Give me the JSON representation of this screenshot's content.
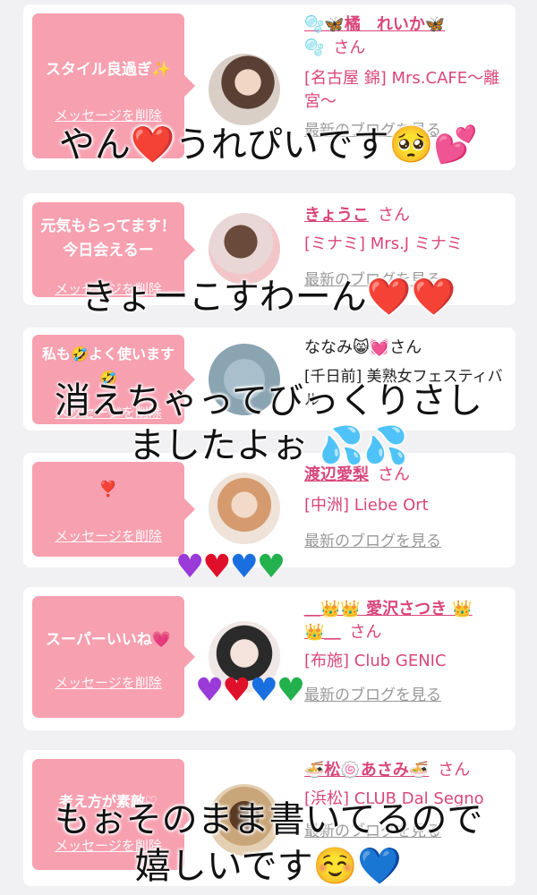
{
  "delete_label": "メッセージを削除",
  "blog_label": "最新のブログを見る",
  "cards": [
    {
      "message": "スタイル良過ぎ✨",
      "name": "🫧🦋橘　れいか🦋",
      "name_line2": "🫧",
      "san": "さん",
      "shop": "[名古屋 錦] Mrs.CAFE〜離宮〜"
    },
    {
      "message": "元気もらってます！今日会えるー",
      "name": "きょうこ",
      "san": "さん",
      "shop": "[ミナミ] Mrs.J ミナミ"
    },
    {
      "message": "私も🤣よく使います🤣",
      "name": "ななみ😸💓さん",
      "shop": "[千日前] 美熟女フェスティバル"
    },
    {
      "message": "❣️",
      "name": "渡辺愛梨",
      "san": "さん",
      "shop": "[中洲] Liebe Ort"
    },
    {
      "message": "スーパーいいね💗",
      "name": "＿👑👑 愛沢さつき 👑",
      "name_line2": "👑＿",
      "san": "さん",
      "shop": "[布施] Club GENIC"
    },
    {
      "message": "考え方が素敵♡",
      "name": "🍜松🍥あさみ🍜",
      "san": "さん",
      "shop": "[浜松] CLUB Dal Segno"
    }
  ],
  "overlays": {
    "line1": "やん❤️うれぴいです🥺💕",
    "line2": "きょーこすわーん❤️❤️",
    "line3a": "消えちゃってびっくりさし",
    "line3b": "ましたよぉ 💦💦",
    "line5a": "もぉそのまま書いてるので",
    "line5b": "嬉しいです☺️💙"
  },
  "colors": {
    "accent": "#d9467a",
    "bubble": "#f7a0b0"
  }
}
